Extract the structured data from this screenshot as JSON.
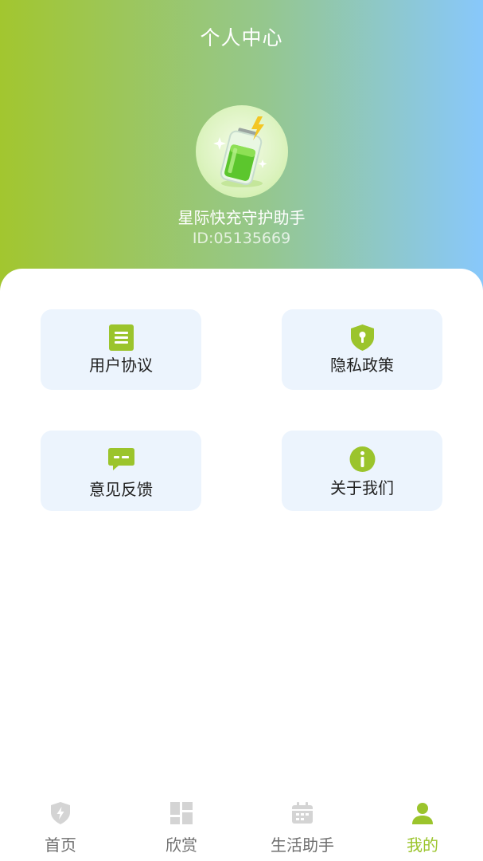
{
  "header": {
    "title": "个人中心",
    "username": "星际快充守护助手",
    "user_id": "ID:05135669"
  },
  "menu": [
    {
      "label": "用户协议",
      "icon": "document-icon"
    },
    {
      "label": "隐私政策",
      "icon": "shield-lock-icon"
    },
    {
      "label": "意见反馈",
      "icon": "chat-icon"
    },
    {
      "label": "关于我们",
      "icon": "info-icon"
    }
  ],
  "tabbar": {
    "items": [
      {
        "label": "首页",
        "icon": "shield-bolt-icon"
      },
      {
        "label": "欣赏",
        "icon": "grid-icon"
      },
      {
        "label": "生活助手",
        "icon": "calendar-icon"
      },
      {
        "label": "我的",
        "icon": "user-icon"
      }
    ],
    "active": "我的"
  },
  "colors": {
    "accent": "#9bc42c",
    "gradient_left": "#a2c62f",
    "gradient_right": "#88c8fb",
    "card_bg": "#ecf4fd",
    "tab_inactive": "#6f6f6f",
    "tab_icon_inactive": "#d4d4d4"
  }
}
